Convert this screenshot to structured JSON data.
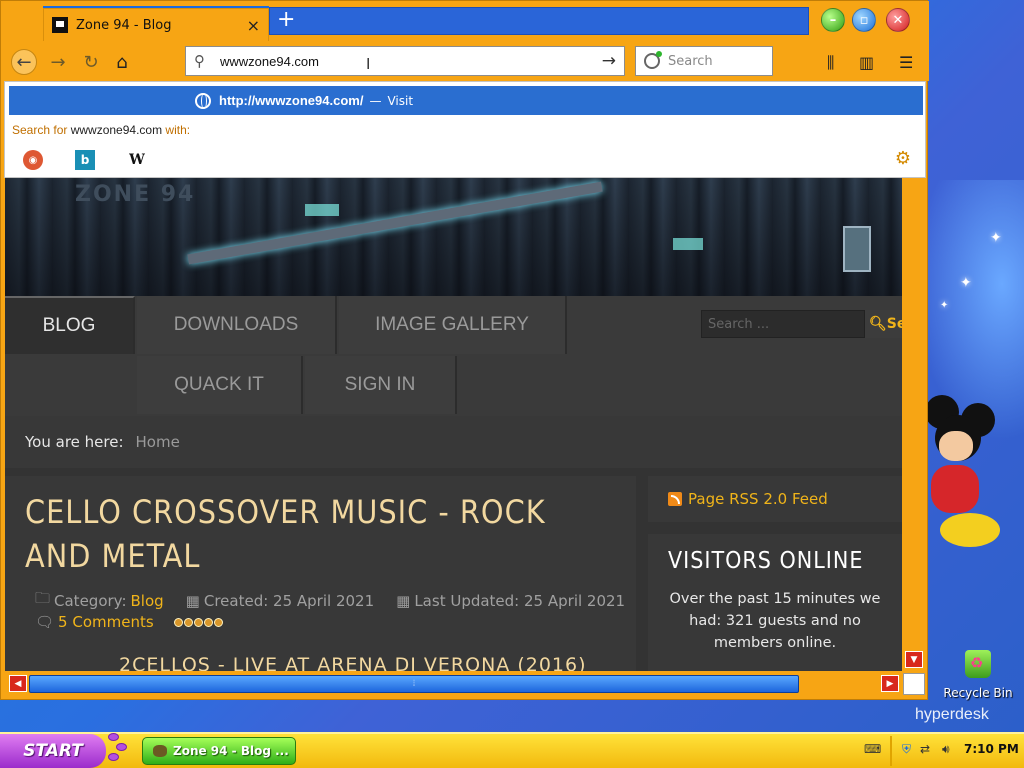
{
  "browser": {
    "tab": {
      "title": "Zone 94 - Blog",
      "close_icon": "×"
    },
    "new_tab_icon": "+",
    "url": "wwwzone94.com",
    "search_placeholder": "Search",
    "dropdown": {
      "suggestion_url": "http://wwwzone94.com/",
      "suggestion_sep": "—",
      "suggestion_action": "Visit",
      "search_for_prefix": "Search for",
      "search_for_query": "wwwzone94.com",
      "search_for_suffix": "with:",
      "engines": [
        "duckduckgo",
        "bing",
        "wikipedia"
      ],
      "wiki_label": "W",
      "bing_label": "b"
    }
  },
  "site": {
    "menu": {
      "blog": "BLOG",
      "downloads": "DOWNLOADS",
      "gallery": "IMAGE GALLERY",
      "quack": "QUACK IT",
      "signin": "SIGN IN"
    },
    "search_placeholder": "Search ...",
    "search_button": "Se",
    "breadcrumb": {
      "label": "You are here:",
      "home": "Home"
    },
    "article": {
      "title": "CELLO CROSSOVER MUSIC - ROCK AND METAL",
      "category_label": "Category:",
      "category": "Blog",
      "created": "Created: 25 April 2021",
      "updated": "Last Updated: 25 April 2021",
      "comments": "5 Comments",
      "rating_stars": 5,
      "subheading": "2CELLOS - LIVE AT ARENA DI VERONA (2016)"
    },
    "rss": "Page RSS 2.0 Feed",
    "visitors": {
      "title": "VISITORS ONLINE",
      "body": "Over the past 15 minutes we had: 321 guests and no members online."
    }
  },
  "desktop": {
    "recycle_bin": "Recycle Bin",
    "brand": "hyperdesk"
  },
  "taskbar": {
    "start": "START",
    "task": "Zone 94 - Blog ...",
    "clock": "7:10 PM"
  },
  "colors": {
    "window_frame": "#f7a514",
    "accent_blue": "#2a6ed0",
    "site_link": "#f0b41a",
    "taskbar": "#f2b90d"
  }
}
